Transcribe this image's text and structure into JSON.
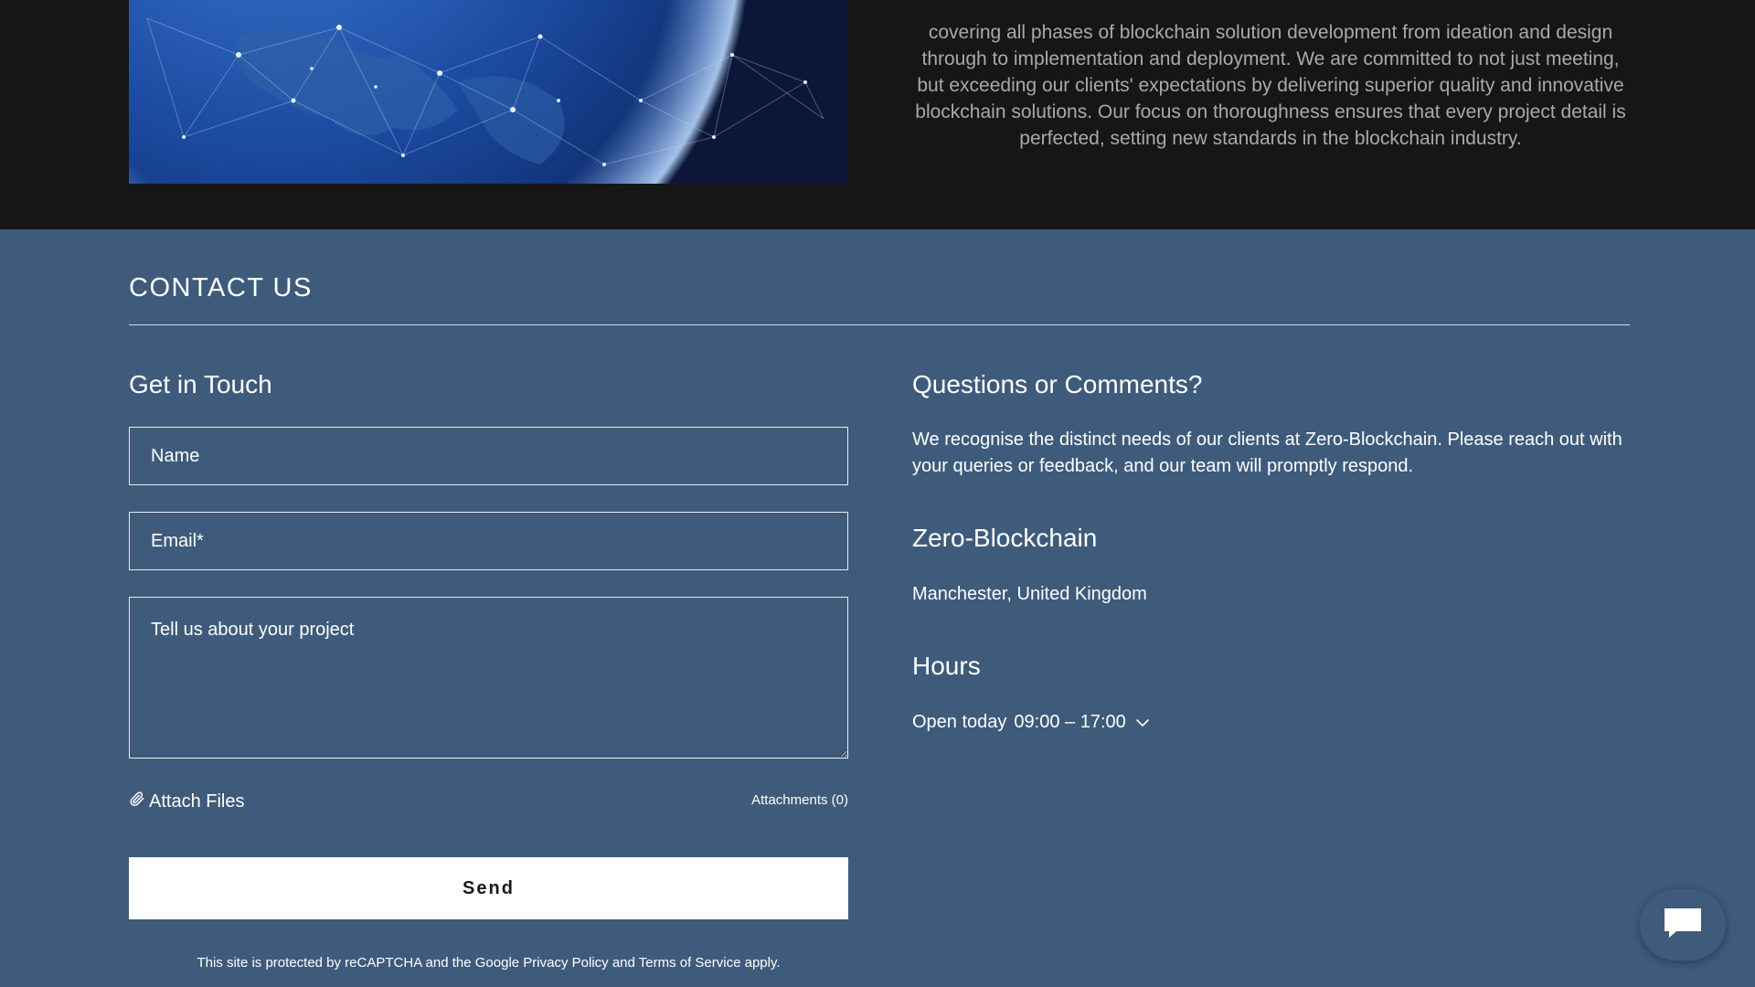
{
  "about": {
    "text": "covering all phases of blockchain solution development from ideation and design through to implementation and deployment. We are committed to not just meeting, but exceeding our clients' expectations by delivering superior quality and innovative blockchain solutions. Our focus on thoroughness ensures that every project detail is perfected, setting new standards in the blockchain industry."
  },
  "contact": {
    "title": "CONTACT US",
    "form": {
      "heading": "Get in Touch",
      "name_placeholder": "Name",
      "email_placeholder": "Email*",
      "message_placeholder": "Tell us about your project",
      "attach_label": "Attach Files",
      "attachments_label": "Attachments (0)",
      "send_label": "Send",
      "recaptcha": {
        "prefix": "This site is protected by reCAPTCHA and the Google ",
        "privacy_link": "Privacy Policy",
        "and": " and ",
        "terms_link": "Terms of Service",
        "suffix": " apply."
      }
    },
    "info": {
      "questions_heading": "Questions or Comments?",
      "questions_body": "We recognise the distinct needs of our clients at Zero-Blockchain. Please reach out with your queries or feedback, and our team will promptly respond.",
      "company_name": "Zero-Blockchain",
      "location": "Manchester, United Kingdom",
      "hours_heading": "Hours",
      "open_label": "Open today",
      "open_time": "09:00 – 17:00"
    }
  },
  "icons": {
    "attach": "paperclip-icon",
    "hours_toggle": "chevron-down-icon",
    "chat": "chat-bubble-icon"
  },
  "colors": {
    "top_background": "#161616",
    "contact_background": "#3f5b7b",
    "body_text_top": "#a9a9a9",
    "button_background": "#ffffff"
  }
}
